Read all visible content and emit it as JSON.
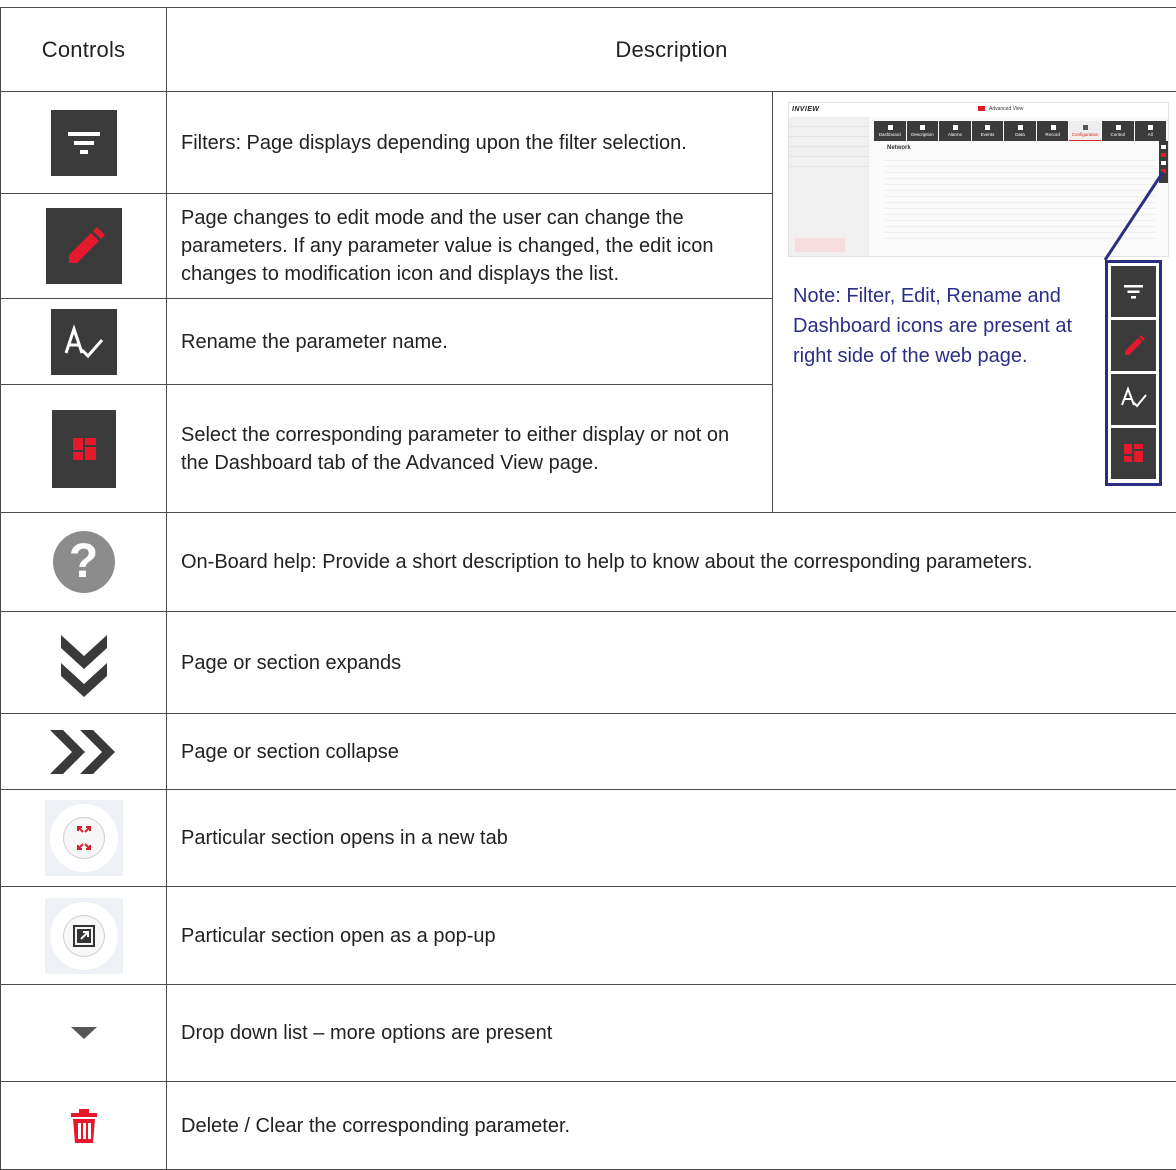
{
  "table": {
    "header": {
      "controls": "Controls",
      "description": "Description"
    },
    "rows": [
      {
        "icon": "filter-icon",
        "description": "Filters: Page displays depending upon the filter selection."
      },
      {
        "icon": "edit-pencil-icon",
        "description": "Page changes to edit mode and the user can change the parameters. If any parameter value is changed, the edit icon changes to modification icon and displays the list."
      },
      {
        "icon": "rename-icon",
        "description": "Rename the parameter name."
      },
      {
        "icon": "dashboard-icon",
        "description": "Select the corresponding parameter to either display or not on the  Dashboard tab of the Advanced View page."
      },
      {
        "icon": "help-icon",
        "description": "On-Board help: Provide a short description to help to know about the corresponding parameters."
      },
      {
        "icon": "expand-chevrons-icon",
        "description": "Page or section expands"
      },
      {
        "icon": "collapse-chevrons-icon",
        "description": "Page or section collapse"
      },
      {
        "icon": "open-new-tab-icon",
        "description": "Particular section opens in a new tab"
      },
      {
        "icon": "popup-icon",
        "description": "Particular section open as a pop-up"
      },
      {
        "icon": "dropdown-arrow-icon",
        "description": "Drop down list – more options are present"
      },
      {
        "icon": "trash-icon",
        "description": "Delete / Clear the corresponding parameter."
      }
    ]
  },
  "panel": {
    "note": "Note: Filter, Edit, Rename and Dashboard icons are present at right side of the web page.",
    "screenshot": {
      "logo": "INVIEW",
      "view_label": "Advanced View",
      "tabs": [
        "Dashboard",
        "Description",
        "Alarms",
        "Events",
        "Data",
        "Record",
        "Configuration",
        "Control",
        "All"
      ],
      "section": "Network"
    }
  },
  "colors": {
    "accent_red": "#e5192b",
    "dark_icon_bg": "#3b3b3b",
    "note_blue": "#2a2f85",
    "help_grey": "#8c8c8c"
  }
}
